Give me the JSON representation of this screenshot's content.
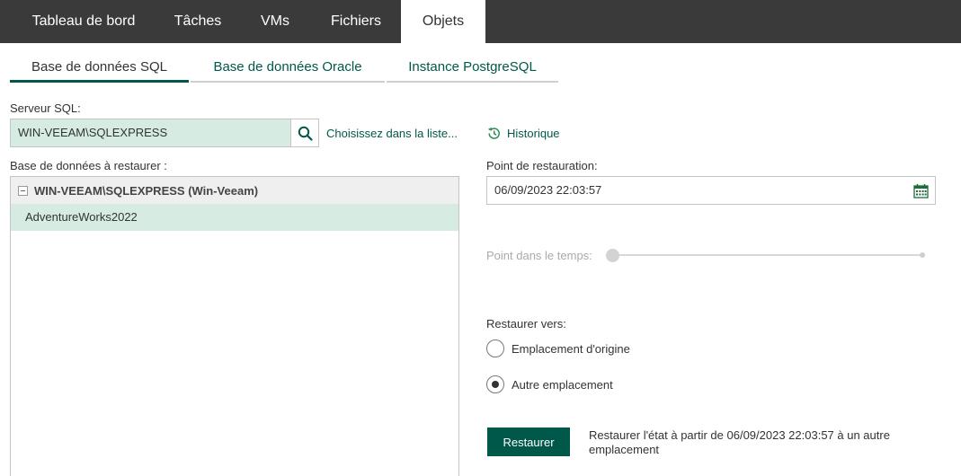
{
  "top_nav": {
    "items": [
      {
        "label": "Tableau de bord"
      },
      {
        "label": "Tâches"
      },
      {
        "label": "VMs"
      },
      {
        "label": "Fichiers"
      },
      {
        "label": "Objets",
        "active": true
      }
    ]
  },
  "sub_tabs": [
    {
      "label": "Base de données SQL",
      "active": true
    },
    {
      "label": "Base de données Oracle"
    },
    {
      "label": "Instance PostgreSQL"
    }
  ],
  "server": {
    "label": "Serveur SQL:",
    "value": "WIN-VEEAM\\SQLEXPRESS",
    "choose_link": "Choisissez dans la liste...",
    "history_link": "Historique"
  },
  "databases": {
    "label": "Base de données à restaurer :",
    "group": "WIN-VEEAM\\SQLEXPRESS (Win-Veeam)",
    "items": [
      "AdventureWorks2022"
    ]
  },
  "restore_point": {
    "label": "Point de restauration:",
    "value": "06/09/2023 22:03:57"
  },
  "point_in_time": {
    "label": "Point dans le temps:",
    "position": 0
  },
  "restore_to": {
    "label": "Restaurer vers:",
    "options": [
      {
        "label": "Emplacement d'origine",
        "checked": false
      },
      {
        "label": "Autre emplacement",
        "checked": true
      }
    ]
  },
  "action": {
    "button": "Restaurer",
    "description": "Restaurer l'état à partir de 06/09/2023 22:03:57 à un autre emplacement"
  },
  "colors": {
    "accent": "#00584a",
    "nav_bg": "#3a3a3a",
    "selection_bg": "#d6ece3"
  }
}
